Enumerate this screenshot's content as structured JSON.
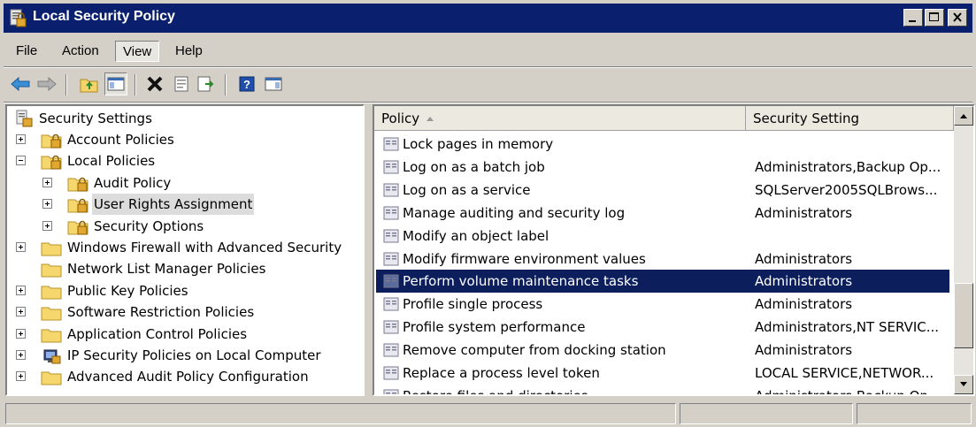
{
  "window": {
    "title": "Local Security Policy",
    "icon": "security-policy-icon",
    "controls": [
      "minimize-icon",
      "maximize-icon",
      "close-icon"
    ]
  },
  "menu": [
    {
      "label": "File"
    },
    {
      "label": "Action"
    },
    {
      "label": "View"
    },
    {
      "label": "Help"
    }
  ],
  "toolbar": [
    "back-arrow-icon",
    "forward-arrow-icon",
    "up-folder-icon",
    "show-hide-tree-icon",
    "delete-icon",
    "properties-icon",
    "export-list-icon",
    "help-icon",
    "show-action-pane-icon"
  ],
  "tree": {
    "root": "Security Settings",
    "items": [
      {
        "label": "Account Policies",
        "expander": "plus",
        "icon": "folder-lock-icon",
        "level": 1
      },
      {
        "label": "Local Policies",
        "expander": "minus",
        "icon": "folder-lock-icon",
        "level": 1
      },
      {
        "label": "Audit Policy",
        "expander": "plus",
        "icon": "folder-lock-icon",
        "level": 2
      },
      {
        "label": "User Rights Assignment",
        "expander": "plus",
        "icon": "folder-lock-icon",
        "level": 2,
        "selected": true
      },
      {
        "label": "Security Options",
        "expander": "plus",
        "icon": "folder-lock-icon",
        "level": 2
      },
      {
        "label": "Windows Firewall with Advanced Security",
        "expander": "plus",
        "icon": "folder-icon",
        "level": 1
      },
      {
        "label": "Network List Manager Policies",
        "expander": "none",
        "icon": "folder-icon",
        "level": 1
      },
      {
        "label": "Public Key Policies",
        "expander": "plus",
        "icon": "folder-icon",
        "level": 1
      },
      {
        "label": "Software Restriction Policies",
        "expander": "plus",
        "icon": "folder-icon",
        "level": 1
      },
      {
        "label": "Application Control Policies",
        "expander": "plus",
        "icon": "folder-icon",
        "level": 1
      },
      {
        "label": "IP Security Policies on Local Computer",
        "expander": "plus",
        "icon": "ip-security-icon",
        "level": 1
      },
      {
        "label": "Advanced Audit Policy Configuration",
        "expander": "plus",
        "icon": "folder-icon",
        "level": 1
      }
    ]
  },
  "list": {
    "columns": [
      "Policy",
      "Security Setting"
    ],
    "rows": [
      {
        "policy": "Lock pages in memory",
        "setting": ""
      },
      {
        "policy": "Log on as a batch job",
        "setting": "Administrators,Backup Op..."
      },
      {
        "policy": "Log on as a service",
        "setting": "SQLServer2005SQLBrows..."
      },
      {
        "policy": "Manage auditing and security log",
        "setting": "Administrators"
      },
      {
        "policy": "Modify an object label",
        "setting": ""
      },
      {
        "policy": "Modify firmware environment values",
        "setting": "Administrators"
      },
      {
        "policy": "Perform volume maintenance tasks",
        "setting": "Administrators",
        "selected": true
      },
      {
        "policy": "Profile single process",
        "setting": "Administrators"
      },
      {
        "policy": "Profile system performance",
        "setting": "Administrators,NT SERVIC..."
      },
      {
        "policy": "Remove computer from docking station",
        "setting": "Administrators"
      },
      {
        "policy": "Replace a process level token",
        "setting": "LOCAL SERVICE,NETWOR..."
      },
      {
        "policy": "Restore files and directories",
        "setting": "Administrators,Backup Op..."
      }
    ]
  },
  "colors": {
    "titlebar": "#0a1f6e",
    "selection": "#0c1f5c",
    "chrome": "#d4d0c8"
  }
}
